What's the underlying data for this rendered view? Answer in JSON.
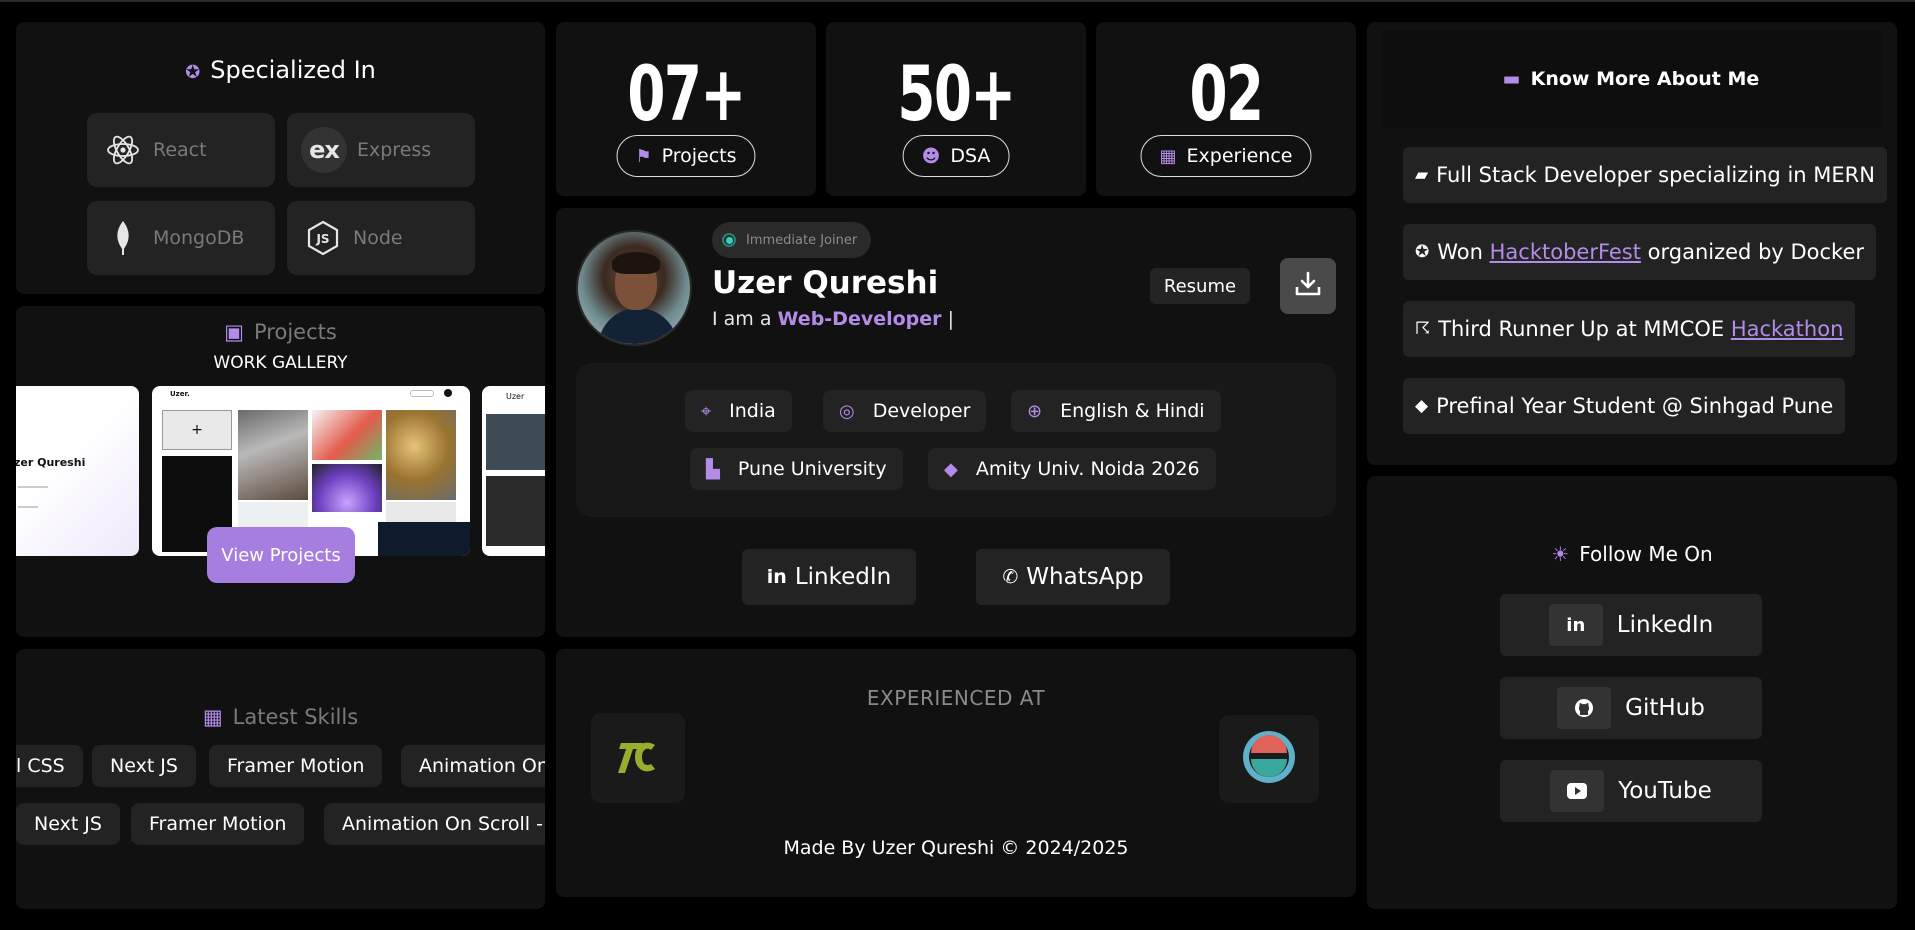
{
  "specialized": {
    "title": "Specialized In",
    "techs": [
      {
        "label": "React",
        "icon": "react-icon"
      },
      {
        "label": "Express",
        "icon": "express-icon",
        "glyph": "ex"
      },
      {
        "label": "MongoDB",
        "icon": "mongodb-leaf-icon"
      },
      {
        "label": "Node",
        "icon": "nodejs-icon"
      }
    ]
  },
  "stats": [
    {
      "value": "07+",
      "label": "Projects",
      "icon": "flag-icon"
    },
    {
      "value": "50+",
      "label": "DSA",
      "icon": "smile-icon"
    },
    {
      "value": "02",
      "label": "Experience",
      "icon": "calendar-icon"
    }
  ],
  "profile": {
    "status": "Immediate Joiner",
    "name": "Uzer Qureshi",
    "tagline_prefix": "I am a ",
    "tagline_role": "Web-Developer",
    "tagline_cursor": "|",
    "resume_label": "Resume",
    "chips": [
      {
        "label": "India",
        "icon": "location-crosshair-icon"
      },
      {
        "label": "Developer",
        "icon": "podcast-icon"
      },
      {
        "label": "English & Hindi",
        "icon": "globe-icon"
      },
      {
        "label": "Pune University",
        "icon": "building-icon"
      },
      {
        "label": "Amity Univ. Noida 2026",
        "icon": "graduation-cap-icon"
      }
    ],
    "socials": [
      {
        "label": "LinkedIn",
        "icon": "linkedin-icon"
      },
      {
        "label": "WhatsApp",
        "icon": "whatsapp-icon"
      }
    ]
  },
  "about": {
    "title": "Know More About Me",
    "facts": [
      {
        "icon": "briefcase-icon",
        "pre": "Full Stack Developer specializing in MERN",
        "link": "",
        "post": ""
      },
      {
        "icon": "award-icon",
        "pre": "Won ",
        "link": "HacktoberFest",
        "post": " organized by Docker"
      },
      {
        "icon": "running-icon",
        "pre": "Third Runner Up at MMCOE ",
        "link": "Hackathon",
        "post": ""
      },
      {
        "icon": "graduation-cap-icon",
        "pre": "Prefinal Year Student @ Sinhgad Pune",
        "link": "",
        "post": ""
      }
    ]
  },
  "projects": {
    "title": "Projects",
    "subtitle": "WORK GALLERY",
    "button": "View Projects",
    "shot_left_name": "zer Qureshi",
    "shot_mid_brand": "Uzer.",
    "shot_right_brand": "Uzer"
  },
  "skills": {
    "title": "Latest Skills",
    "row1": [
      "l CSS",
      "Next JS",
      "Framer Motion",
      "Animation On"
    ],
    "row2": [
      "Next JS",
      "Framer Motion",
      "Animation On Scroll - A"
    ]
  },
  "experience": {
    "title": "EXPERIENCED AT",
    "footer": "Made By Uzer Qureshi © 2024/2025"
  },
  "follow": {
    "title": "Follow Me On",
    "links": [
      {
        "label": "LinkedIn",
        "icon": "linkedin-icon",
        "glyph": "in"
      },
      {
        "label": "GitHub",
        "icon": "github-icon"
      },
      {
        "label": "YouTube",
        "icon": "youtube-icon"
      }
    ]
  },
  "colors": {
    "accent": "#a67ee0",
    "card": "#111111",
    "chip": "#232323",
    "background": "#000000"
  }
}
